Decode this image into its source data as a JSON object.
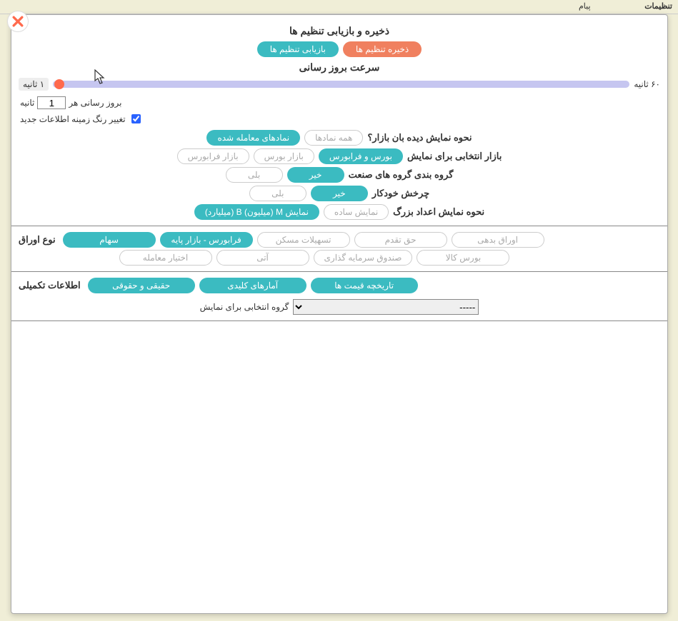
{
  "topbar": {
    "title": "تنظیمات",
    "msg": "پیام"
  },
  "header": {
    "title": "ذخیره و بازیابی تنظیم ها",
    "save_btn": "ذخیره تنظیم ها",
    "restore_btn": "بازیابی تنظیم ها"
  },
  "update_speed": {
    "title": "سرعت بروز رسانی",
    "max_label": "۶۰ ثانیه",
    "min_label": "۱ ثانیه",
    "interval_prefix": "بروز رسانی هر",
    "interval_value": "1",
    "interval_suffix": "ثانیه",
    "color_change_label": "تغییر رنگ زمینه اطلاعات جدید"
  },
  "market_watch": {
    "label": "نحوه نمایش دیده بان بازار؟",
    "opt_all": "همه نمادها",
    "opt_traded": "نمادهای معامله شده"
  },
  "market_select": {
    "label": "بازار انتخابی برای نمایش",
    "opt_both": "بورس و فرابورس",
    "opt_bourse": "بازار بورس",
    "opt_fara": "بازار فرابورس"
  },
  "industry_group": {
    "label": "گروه بندی گروه های صنعت",
    "opt_no": "خیر",
    "opt_yes": "بلی"
  },
  "auto_rotate": {
    "label": "چرخش خودکار",
    "opt_no": "خیر",
    "opt_yes": "بلی"
  },
  "big_numbers": {
    "label": "نحوه نمایش اعداد بزرگ",
    "opt_simple": "نمایش ساده",
    "opt_mb": "نمایش M (میلیون) B (میلیارد)"
  },
  "securities": {
    "label": "نوع اوراق",
    "row1": {
      "stock": "سهام",
      "farabourse_base": "فرابورس - بازار پایه",
      "housing": "تسهیلات مسکن",
      "right": "حق تقدم",
      "debt": "اوراق بدهی"
    },
    "row2": {
      "option": "اختیار معامله",
      "ati": "آتی",
      "fund": "صندوق سرمایه گذاری",
      "commodity": "بورس کالا"
    }
  },
  "extra_info": {
    "label": "اطلاعات تکمیلی",
    "real_legal": "حقیقی و حقوقی",
    "key_stats": "آمارهای کلیدی",
    "price_history": "تاریخچه قیمت ها"
  },
  "group_dropdown": {
    "label": "گروه انتخابی برای نمایش",
    "value": "-----"
  }
}
